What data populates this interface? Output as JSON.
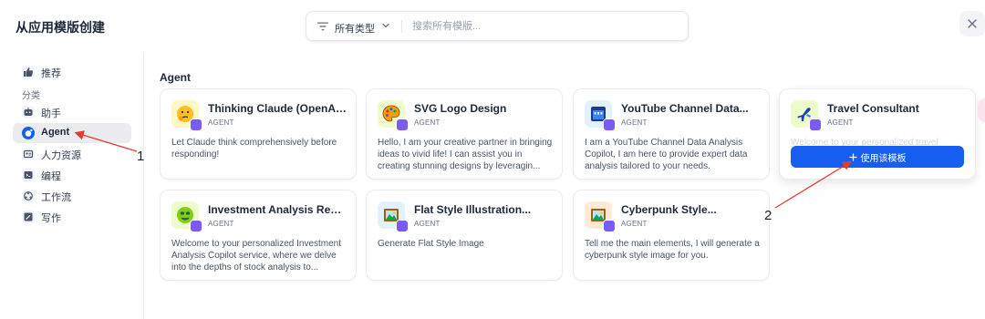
{
  "header": {
    "title": "从应用模版创建",
    "type_filter": "所有类型",
    "search_placeholder": "搜索所有模版..."
  },
  "sidebar": {
    "top_item": {
      "label": "推荐",
      "icon": "thumbs-up-icon"
    },
    "category_label": "分类",
    "items": [
      {
        "label": "助手",
        "icon": "assistant-icon"
      },
      {
        "label": "Agent",
        "icon": "agent-icon",
        "active": true
      },
      {
        "label": "人力资源",
        "icon": "hr-icon"
      },
      {
        "label": "编程",
        "icon": "code-icon"
      },
      {
        "label": "工作流",
        "icon": "workflow-icon"
      },
      {
        "label": "写作",
        "icon": "writing-icon"
      }
    ]
  },
  "main": {
    "section_title": "Agent",
    "cards": [
      {
        "name": "Thinking Claude (OpenAI...",
        "type": "AGENT",
        "desc": "Let Claude think comprehensively before responding!",
        "icon": "thinking-face-icon",
        "icon_bg": "#fef7c3"
      },
      {
        "name": "SVG Logo Design",
        "type": "AGENT",
        "desc": "Hello, I am your creative partner in bringing ideas to vivid life! I can assist you in creating stunning designs by leveragin...",
        "icon": "palette-icon",
        "icon_bg": "#ecfccb"
      },
      {
        "name": "YouTube Channel Data...",
        "type": "AGENT",
        "desc": "I am a YouTube Channel Data Analysis Copilot, I am here to provide expert data analysis tailored to your needs.",
        "icon": "calendar-icon",
        "icon_bg": "#e0f2fe"
      },
      {
        "name": "Travel Consultant",
        "type": "AGENT",
        "desc": "Welcome to your personalized travel",
        "icon": "airplane-icon",
        "icon_bg": "#ecfccb"
      },
      {
        "name": "Investment Analysis Repo...",
        "type": "AGENT",
        "desc": "Welcome to your personalized Investment Analysis Copilot service, where we delve into the depths of stock analysis to...",
        "icon": "money-face-icon",
        "icon_bg": "#ecfccb"
      },
      {
        "name": "Flat Style Illustration...",
        "type": "AGENT",
        "desc": "Generate Flat Style Image",
        "icon": "framed-picture-icon",
        "icon_bg": "#e0f2fe"
      },
      {
        "name": "Cyberpunk Style...",
        "type": "AGENT",
        "desc": "Tell me the main elements, I will generate a cyberpunk style image for you.",
        "icon": "framed-picture-icon",
        "icon_bg": "#ffead5"
      }
    ],
    "use_template_label": "使用该模板"
  },
  "annotations": {
    "label_1": "1",
    "label_2": "2"
  },
  "colors": {
    "primary": "#155eef",
    "badge": "#7a5af8",
    "arrow": "#e53935"
  }
}
